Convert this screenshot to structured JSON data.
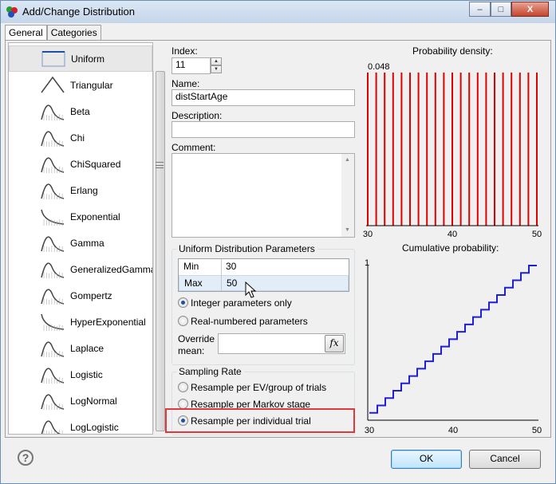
{
  "window": {
    "title": "Add/Change Distribution",
    "minimize": "–",
    "maximize": "□",
    "close": "X"
  },
  "tabs": [
    {
      "label": "General",
      "active": true
    },
    {
      "label": "Categories",
      "active": false
    }
  ],
  "distributions": [
    {
      "label": "Uniform",
      "icon": "uniform-icon",
      "selected": true
    },
    {
      "label": "Triangular",
      "icon": "triangular-icon"
    },
    {
      "label": "Beta",
      "icon": "beta-icon"
    },
    {
      "label": "Chi",
      "icon": "chi-icon"
    },
    {
      "label": "ChiSquared",
      "icon": "chisquared-icon"
    },
    {
      "label": "Erlang",
      "icon": "erlang-icon"
    },
    {
      "label": "Exponential",
      "icon": "exponential-icon"
    },
    {
      "label": "Gamma",
      "icon": "gamma-icon"
    },
    {
      "label": "GeneralizedGamma",
      "icon": "generalizedgamma-icon"
    },
    {
      "label": "Gompertz",
      "icon": "gompertz-icon"
    },
    {
      "label": "HyperExponential",
      "icon": "hyperexponential-icon"
    },
    {
      "label": "Laplace",
      "icon": "laplace-icon"
    },
    {
      "label": "Logistic",
      "icon": "logistic-icon"
    },
    {
      "label": "LogNormal",
      "icon": "lognormal-icon"
    },
    {
      "label": "LogLogistic",
      "icon": "loglogistic-icon"
    }
  ],
  "form": {
    "index_label": "Index:",
    "index_value": "11",
    "name_label": "Name:",
    "name_value": "distStartAge",
    "description_label": "Description:",
    "description_value": "",
    "comment_label": "Comment:",
    "comment_value": ""
  },
  "params": {
    "group_title": "Uniform Distribution Parameters",
    "rows": [
      {
        "name": "Min",
        "value": "30"
      },
      {
        "name": "Max",
        "value": "50"
      }
    ],
    "integer_label": "Integer parameters only",
    "integer_selected": true,
    "real_label": "Real-numbered parameters",
    "real_selected": false,
    "override_label_1": "Override",
    "override_label_2": "mean:",
    "override_value": "",
    "fx_label": "fx"
  },
  "sampling": {
    "group_title": "Sampling Rate",
    "options": [
      {
        "label": "Resample per EV/group of trials",
        "selected": false
      },
      {
        "label": "Resample per Markov stage",
        "selected": false
      },
      {
        "label": "Resample per individual trial",
        "selected": true
      }
    ]
  },
  "buttons": {
    "ok": "OK",
    "cancel": "Cancel",
    "help": "?"
  },
  "colors": {
    "density": "#e00000",
    "cumulative": "#1f1fd6",
    "highlight": "#e0393c"
  },
  "chart_data": [
    {
      "type": "bar",
      "title": "Probability density:",
      "x": [
        30,
        31,
        32,
        33,
        34,
        35,
        36,
        37,
        38,
        39,
        40,
        41,
        42,
        43,
        44,
        45,
        46,
        47,
        48,
        49,
        50
      ],
      "values": [
        0.048,
        0.048,
        0.048,
        0.048,
        0.048,
        0.048,
        0.048,
        0.048,
        0.048,
        0.048,
        0.048,
        0.048,
        0.048,
        0.048,
        0.048,
        0.048,
        0.048,
        0.048,
        0.048,
        0.048,
        0.048
      ],
      "annotation": "0.048",
      "xticks": [
        "30",
        "40",
        "50"
      ],
      "xlim": [
        30,
        50
      ]
    },
    {
      "type": "line",
      "title": "Cumulative probability:",
      "x": [
        30,
        31,
        32,
        33,
        34,
        35,
        36,
        37,
        38,
        39,
        40,
        41,
        42,
        43,
        44,
        45,
        46,
        47,
        48,
        49,
        50
      ],
      "values": [
        0.0476,
        0.0952,
        0.1429,
        0.1905,
        0.2381,
        0.2857,
        0.3333,
        0.381,
        0.4286,
        0.4762,
        0.5238,
        0.5714,
        0.619,
        0.6667,
        0.7143,
        0.7619,
        0.8095,
        0.8571,
        0.9048,
        0.9524,
        1.0
      ],
      "yticks": [
        "1"
      ],
      "xticks": [
        "30",
        "40",
        "50"
      ],
      "xlim": [
        30,
        50
      ],
      "ylim": [
        0,
        1
      ]
    }
  ]
}
